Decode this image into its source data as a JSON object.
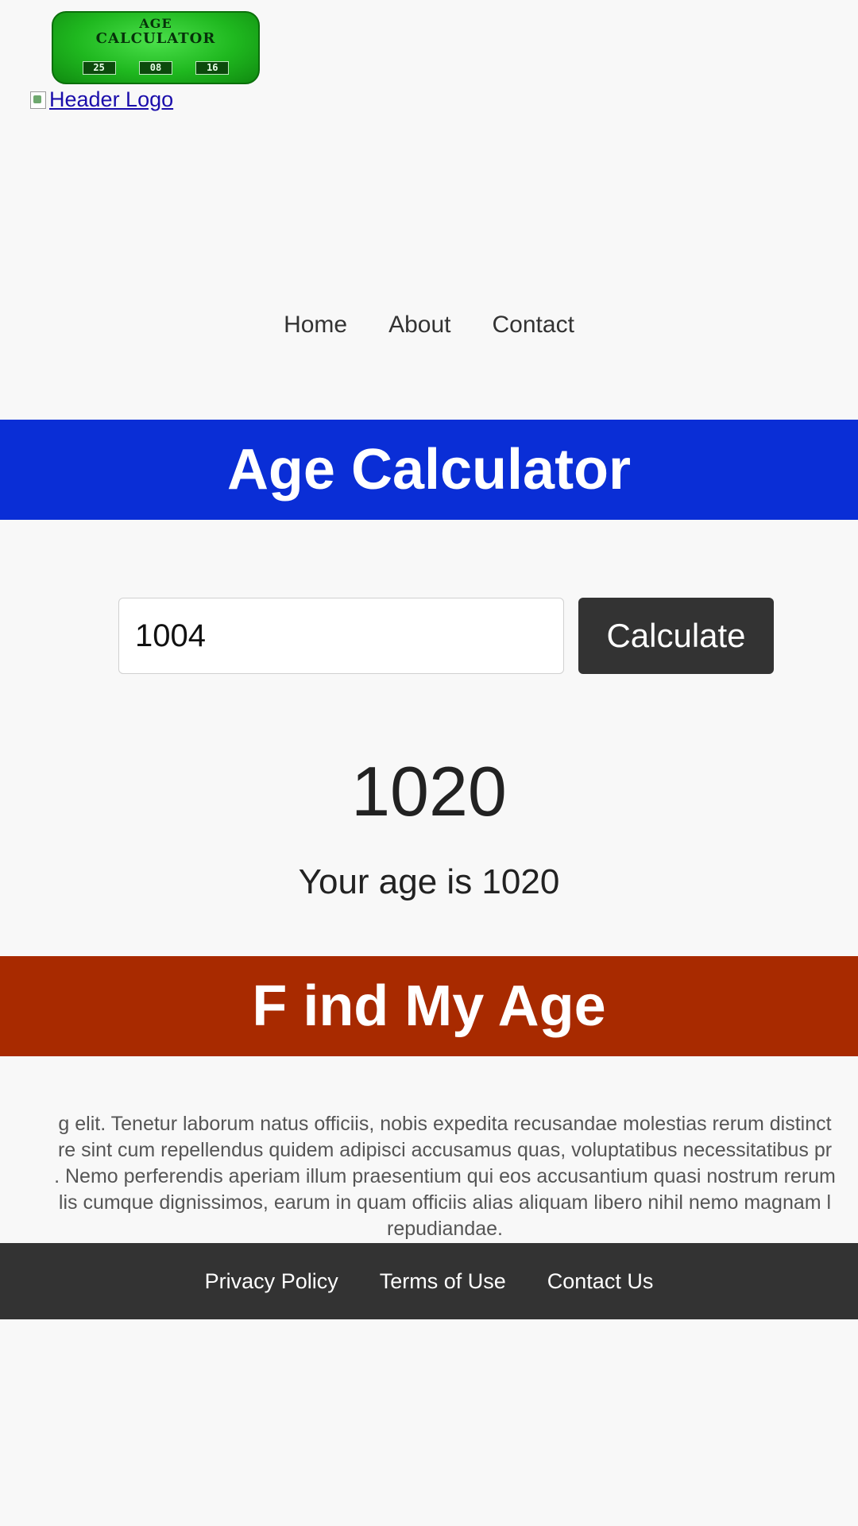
{
  "logo": {
    "line1": "AGE",
    "line2": "CALCULATOR",
    "boxes": [
      "25",
      "08",
      "16"
    ]
  },
  "header_logo_alt": "Header Logo",
  "nav": {
    "items": [
      "Home",
      "About",
      "Contact"
    ]
  },
  "banner_title": "Age Calculator",
  "form": {
    "input_value": "1004",
    "button_label": "Calculate"
  },
  "result": {
    "value": "1020",
    "text": "Your age is 1020"
  },
  "secondary_banner": "F ind My Age",
  "lorem_lines": [
    "g elit. Tenetur laborum natus officiis, nobis expedita recusandae molestias rerum distinct",
    "re sint cum repellendus quidem adipisci accusamus quas, voluptatibus necessitatibus pr",
    ". Nemo perferendis aperiam illum praesentium qui eos accusantium quasi nostrum rerum",
    "lis cumque dignissimos, earum in quam officiis alias aliquam libero nihil nemo magnam l",
    "repudiandae."
  ],
  "footer": {
    "links": [
      "Privacy Policy",
      "Terms of Use",
      "Contact Us"
    ]
  },
  "colors": {
    "banner_blue": "#0a2ed6",
    "banner_red": "#a82a00",
    "dark": "#333333"
  }
}
